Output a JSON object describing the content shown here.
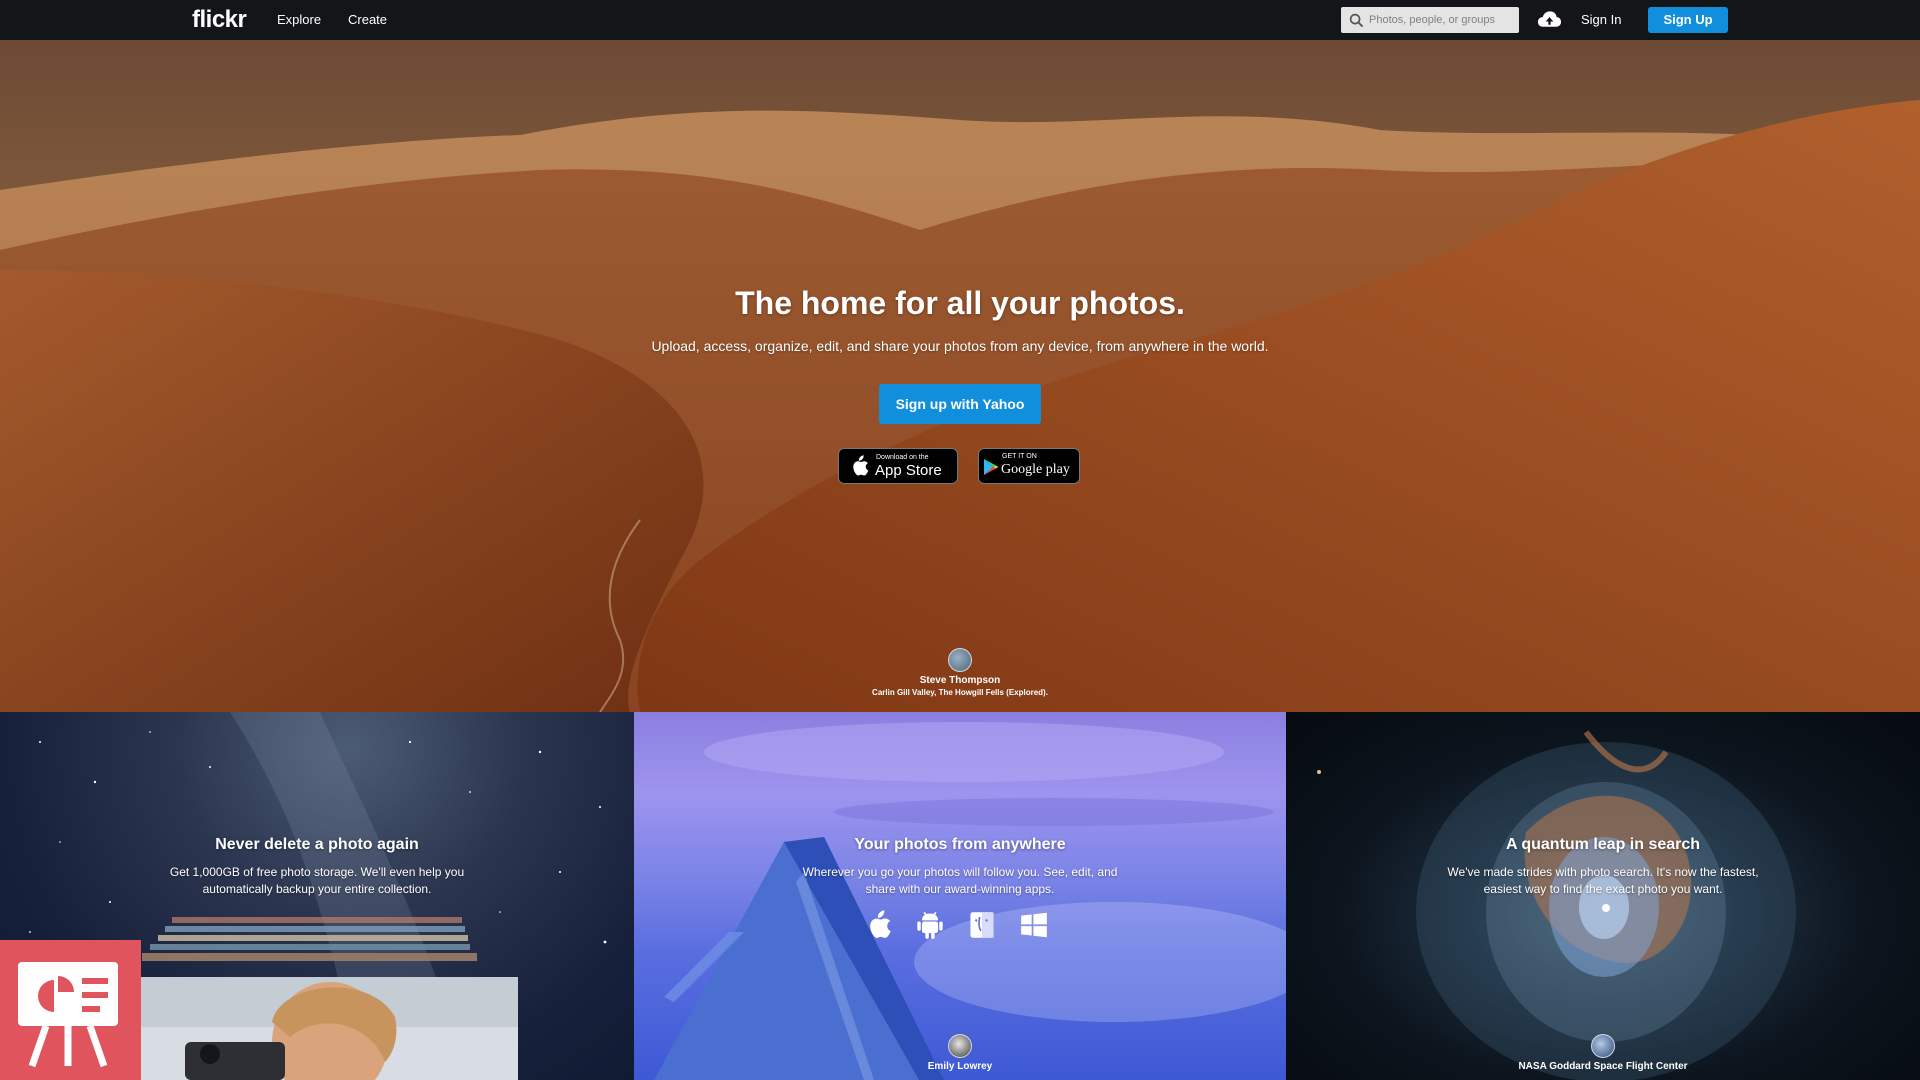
{
  "header": {
    "logo": "flickr",
    "nav": [
      {
        "label": "Explore"
      },
      {
        "label": "Create"
      }
    ],
    "search": {
      "placeholder": "Photos, people, or groups"
    },
    "upload_icon": "cloud-upload-icon",
    "sign_in": "Sign In",
    "sign_up": "Sign Up"
  },
  "hero": {
    "title": "The home for all your photos.",
    "subtitle": "Upload, access, organize, edit, and share your photos from any device, from anywhere in the world.",
    "cta": "Sign up with Yahoo",
    "app_store": {
      "small": "Download on the",
      "big": "App Store"
    },
    "google_play": {
      "small": "GET IT ON",
      "big": "Google play"
    },
    "credit": {
      "author": "Steve Thompson",
      "caption": "Carlin Gill Valley, The Howgill Fells (Explored)."
    }
  },
  "panels": {
    "storage": {
      "title": "Never delete a photo again",
      "text": "Get 1,000GB of free photo storage. We'll even help you automatically backup your entire collection."
    },
    "anywhere": {
      "title": "Your photos from anywhere",
      "text": "Wherever you go your photos will follow you. See, edit, and share with our award-winning apps.",
      "platforms": [
        "apple-icon",
        "android-icon",
        "mac-finder-icon",
        "windows-icon"
      ],
      "credit": {
        "author": "Emily Lowrey"
      }
    },
    "search": {
      "title": "A quantum leap in search",
      "text": "We've made strides with photo search. It's now the fastest, easiest way to find the exact photo you want.",
      "credit": {
        "author": "NASA Goddard Space Flight Center"
      }
    }
  },
  "colors": {
    "header_bg": "#141519",
    "accent_blue": "#128fdc",
    "feedback_badge": "#e0555d"
  }
}
